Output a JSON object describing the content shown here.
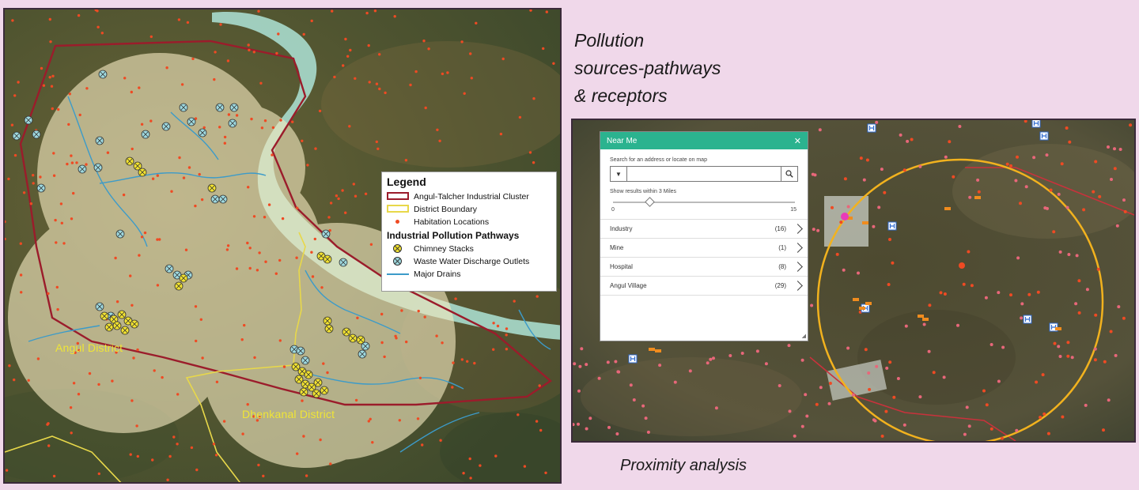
{
  "captions": {
    "title_line1": "Pollution",
    "title_line2": "sources-pathways",
    "title_line3": "& receptors",
    "proximity": "Proximity  analysis"
  },
  "left_map": {
    "labels": {
      "angul": "Angul District",
      "dhenkanal": "Dhenkanal District"
    },
    "legend": {
      "title": "Legend",
      "items": [
        {
          "label": "Angul-Talcher Industrial Cluster"
        },
        {
          "label": "District Boundary"
        },
        {
          "label": "Habitation Locations"
        }
      ],
      "subtitle": "Industrial Pollution Pathways",
      "pathways": [
        {
          "label": "Chimney Stacks"
        },
        {
          "label": "Waste Water Discharge Outlets"
        },
        {
          "label": "Major Drains"
        }
      ]
    },
    "colors": {
      "cluster_boundary": "#9b1c2b",
      "district_boundary": "#e8d84a",
      "habitation": "#ef4a23",
      "chimney": "#f2e230",
      "waste_water": "#9ed9df",
      "drains": "#3c9bc9",
      "buffer": "#f3e9c0"
    }
  },
  "near_me": {
    "title": "Near Me",
    "search_hint": "Search for an address or locate on map",
    "search_placeholder": "",
    "range_label": "Show results within 3 Miles",
    "range_min": "0",
    "range_max": "15",
    "range_value": 3,
    "items": [
      {
        "label": "Industry",
        "count": "(16)"
      },
      {
        "label": "Mine",
        "count": "(1)"
      },
      {
        "label": "Hospital",
        "count": "(8)"
      },
      {
        "label": "Angul Village",
        "count": "(29)"
      }
    ],
    "header_color": "#2bb38f"
  }
}
